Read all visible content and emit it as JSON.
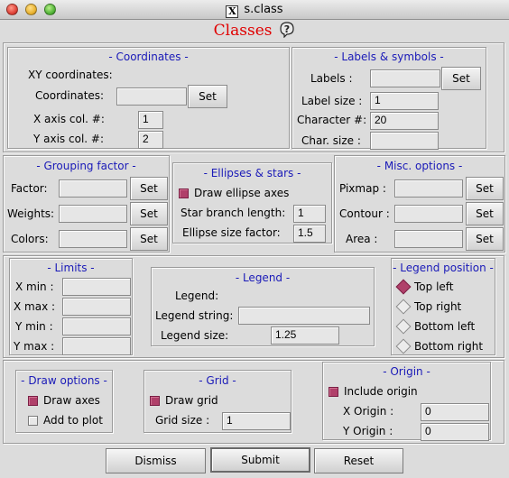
{
  "window": {
    "title": "s.class"
  },
  "heading": "Classes",
  "coordinates": {
    "title": "- Coordinates -",
    "xy_label": "XY coordinates:",
    "coords_label": "Coordinates:",
    "coords_value": "",
    "set_label": "Set",
    "xaxis_label": "X axis col. #:",
    "xaxis_value": "1",
    "yaxis_label": "Y axis col. #:",
    "yaxis_value": "2"
  },
  "labels_symbols": {
    "title": "- Labels & symbols -",
    "labels_label": "Labels :",
    "labels_value": "",
    "set_label": "Set",
    "label_size_label": "Label size :",
    "label_size_value": "1",
    "character_label": "Character #:",
    "character_value": "20",
    "char_size_label": "Char. size :",
    "char_size_value": ""
  },
  "grouping": {
    "title": "- Grouping factor -",
    "factor_label": "Factor:",
    "weights_label": "Weights:",
    "colors_label": "Colors:",
    "set_label": "Set"
  },
  "ellipses": {
    "title": "- Ellipses & stars -",
    "draw_ellipse_label": "Draw ellipse axes",
    "draw_ellipse_checked": true,
    "star_label": "Star branch length:",
    "star_value": "1",
    "ellipse_size_label": "Ellipse size factor:",
    "ellipse_size_value": "1.5"
  },
  "misc": {
    "title": "- Misc. options -",
    "pixmap_label": "Pixmap :",
    "contour_label": "Contour :",
    "area_label": "Area :",
    "set_label": "Set"
  },
  "limits": {
    "title": "- Limits -",
    "xmin_label": "X min :",
    "xmax_label": "X max :",
    "ymin_label": "Y min :",
    "ymax_label": "Y max :"
  },
  "legend": {
    "title": "- Legend -",
    "legend_label": "Legend:",
    "string_label": "Legend string:",
    "string_value": "",
    "size_label": "Legend size:",
    "size_value": "1.25"
  },
  "legend_position": {
    "title": "- Legend position -",
    "options": [
      "Top left",
      "Top right",
      "Bottom left",
      "Bottom right"
    ],
    "selected": "Top left"
  },
  "draw_options": {
    "title": "- Draw options -",
    "draw_axes_label": "Draw axes",
    "draw_axes_checked": true,
    "add_plot_label": "Add to plot",
    "add_plot_checked": false
  },
  "grid": {
    "title": "- Grid -",
    "draw_grid_label": "Draw grid",
    "draw_grid_checked": true,
    "grid_size_label": "Grid size :",
    "grid_size_value": "1"
  },
  "origin": {
    "title": "- Origin -",
    "include_label": "Include origin",
    "include_checked": true,
    "x_label": "X Origin :",
    "x_value": "0",
    "y_label": "Y Origin :",
    "y_value": "0"
  },
  "buttons": {
    "dismiss": "Dismiss",
    "submit": "Submit",
    "reset": "Reset"
  },
  "colors": {
    "heading_red": "#e00000",
    "group_title_blue": "#1a1ab8",
    "check_on": "#b0406a"
  },
  "icons": {
    "close": "close-dot",
    "minimize": "minimize-dot",
    "zoom": "zoom-dot",
    "x11": "x11-icon",
    "help": "question-balloon-icon"
  }
}
